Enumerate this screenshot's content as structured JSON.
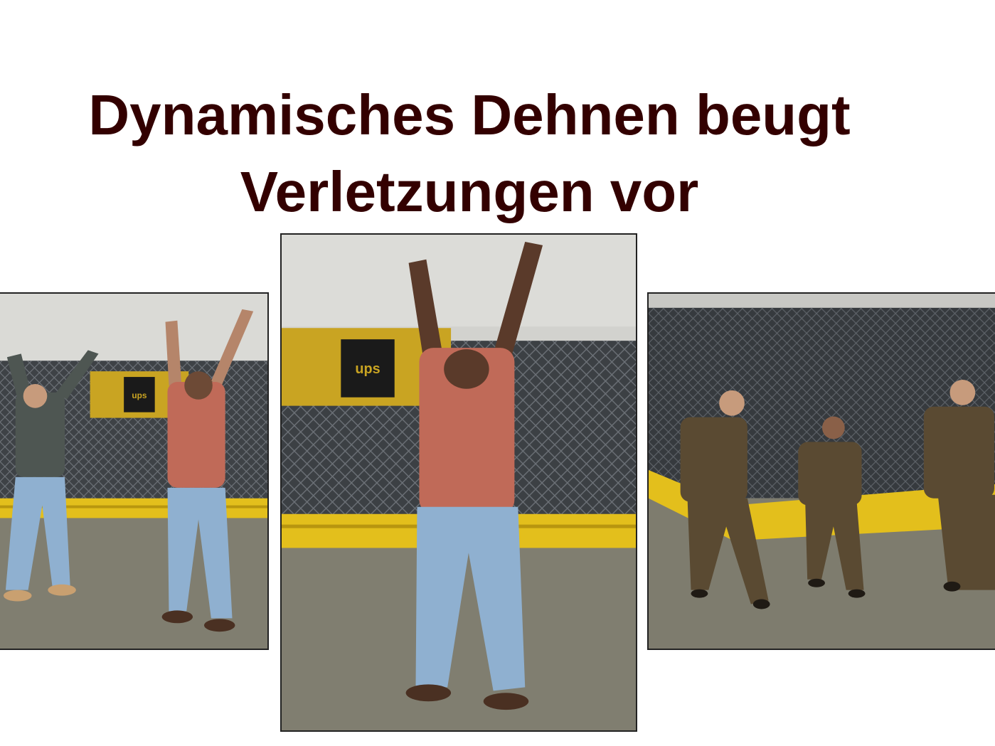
{
  "slide": {
    "title_line1": "Dynamisches Dehnen beugt",
    "title_line2": "Verletzungen vor"
  },
  "photos": {
    "left": {
      "subject": "two workers stretching arms overhead"
    },
    "center": {
      "subject": "worker stretching arms overhead"
    },
    "right": {
      "subject": "three workers in brown uniforms doing leg stretch"
    },
    "sign_text": "ups"
  },
  "colors": {
    "title": "#330000",
    "wall": "#d6d6d2",
    "fence": "#4a4e52",
    "floor": "#7d7c6e",
    "rail": "#e6c21a",
    "banner_gold": "#c9a422",
    "uniform": "#5a4a32",
    "shirt_red": "#c06a58",
    "shirt_gray": "#4e5652",
    "jeans": "#8fb0d0"
  }
}
